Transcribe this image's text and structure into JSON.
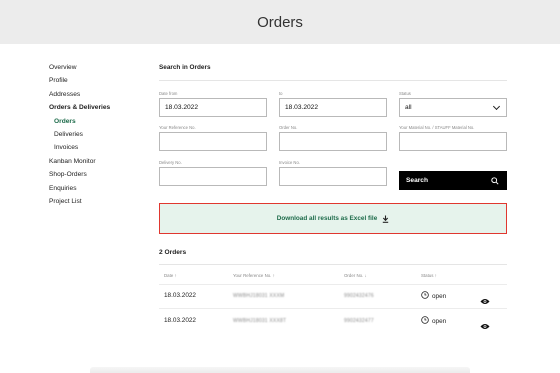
{
  "header": {
    "title": "Orders"
  },
  "sidebar": {
    "items": [
      {
        "label": "Overview"
      },
      {
        "label": "Profile"
      },
      {
        "label": "Addresses"
      },
      {
        "label": "Orders & Deliveries"
      },
      {
        "label": "Orders"
      },
      {
        "label": "Deliveries"
      },
      {
        "label": "Invoices"
      },
      {
        "label": "Kanban Monitor"
      },
      {
        "label": "Shop-Orders"
      },
      {
        "label": "Enquiries"
      },
      {
        "label": "Project List"
      }
    ]
  },
  "search": {
    "title": "Search in Orders",
    "date_from": {
      "label": "Date from",
      "value": "18.03.2022"
    },
    "date_to": {
      "label": "to",
      "value": "18.03.2022"
    },
    "status": {
      "label": "Status",
      "value": "all"
    },
    "your_ref": {
      "label": "Your Reference No.",
      "value": ""
    },
    "order_no": {
      "label": "Order No.",
      "value": ""
    },
    "material_no": {
      "label": "Your Material No. / STAUFF Material No.",
      "value": ""
    },
    "delivery_no": {
      "label": "Delivery No.",
      "value": ""
    },
    "invoice_no": {
      "label": "Invoice No.",
      "value": ""
    },
    "button_label": "Search"
  },
  "download": {
    "label": "Download all results as Excel file"
  },
  "orders": {
    "count_label": "2 Orders",
    "columns": {
      "date": "Date ↑",
      "your_ref": "Your Reference No. ↑",
      "order_no": "Order No. ↓",
      "status": "Status ↑"
    },
    "rows": [
      {
        "date": "18.03.2022",
        "your_ref": "WWBHJ18031 XXXM",
        "order_no": "9902432476",
        "status": "open"
      },
      {
        "date": "18.03.2022",
        "your_ref": "WWBHJ18031 XXX8T",
        "order_no": "9902432477",
        "status": "open"
      }
    ]
  },
  "colors": {
    "accent_green": "#1d6b4a",
    "download_bg": "#e6f3ec",
    "download_border": "#e0372f",
    "header_bg": "#ececec"
  }
}
